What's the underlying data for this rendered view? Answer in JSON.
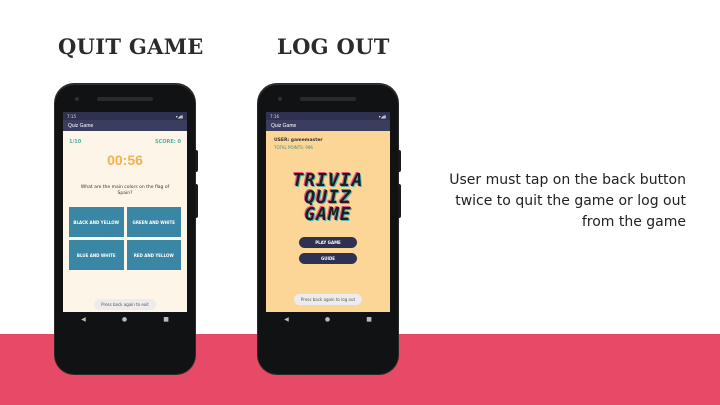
{
  "headings": {
    "quit": "QUIT GAME",
    "logout": "LOG OUT"
  },
  "caption": "User must tap on the back button twice to quit the game or log out from the game",
  "phone_left": {
    "status_time": "7:15",
    "status_icons": "▾◢▮",
    "app_title": "Quiz Game",
    "progress": "1/10",
    "score": "SCORE: 0",
    "timer": "00:56",
    "question": "What are the main colors on the flag of Spain?",
    "options": [
      "BLACK AND YELLOW",
      "GREEN AND WHITE",
      "BLUE AND WHITE",
      "RED AND YELLOW"
    ],
    "toast": "Press back again to exit"
  },
  "phone_right": {
    "status_time": "7:16",
    "status_icons": "▾◢▮",
    "app_title": "Quiz Game",
    "user": "USER: gamemaster",
    "points": "TOTAL POINTS: 996",
    "logo": [
      "TRIVIA",
      "QUIZ",
      "GAME"
    ],
    "play_button": "PLAY GAME",
    "guide_button": "GUIDE",
    "toast": "Press back again to log out"
  },
  "nav_icons": {
    "back": "◀",
    "home": "●",
    "recents": "■"
  },
  "colors": {
    "band": "#e74a66",
    "quiz_bg": "#fdf6e8",
    "trivia_bg": "#fcd697",
    "option": "#3a87a5",
    "timer": "#f0b251",
    "appbar": "#3a3d5e"
  }
}
